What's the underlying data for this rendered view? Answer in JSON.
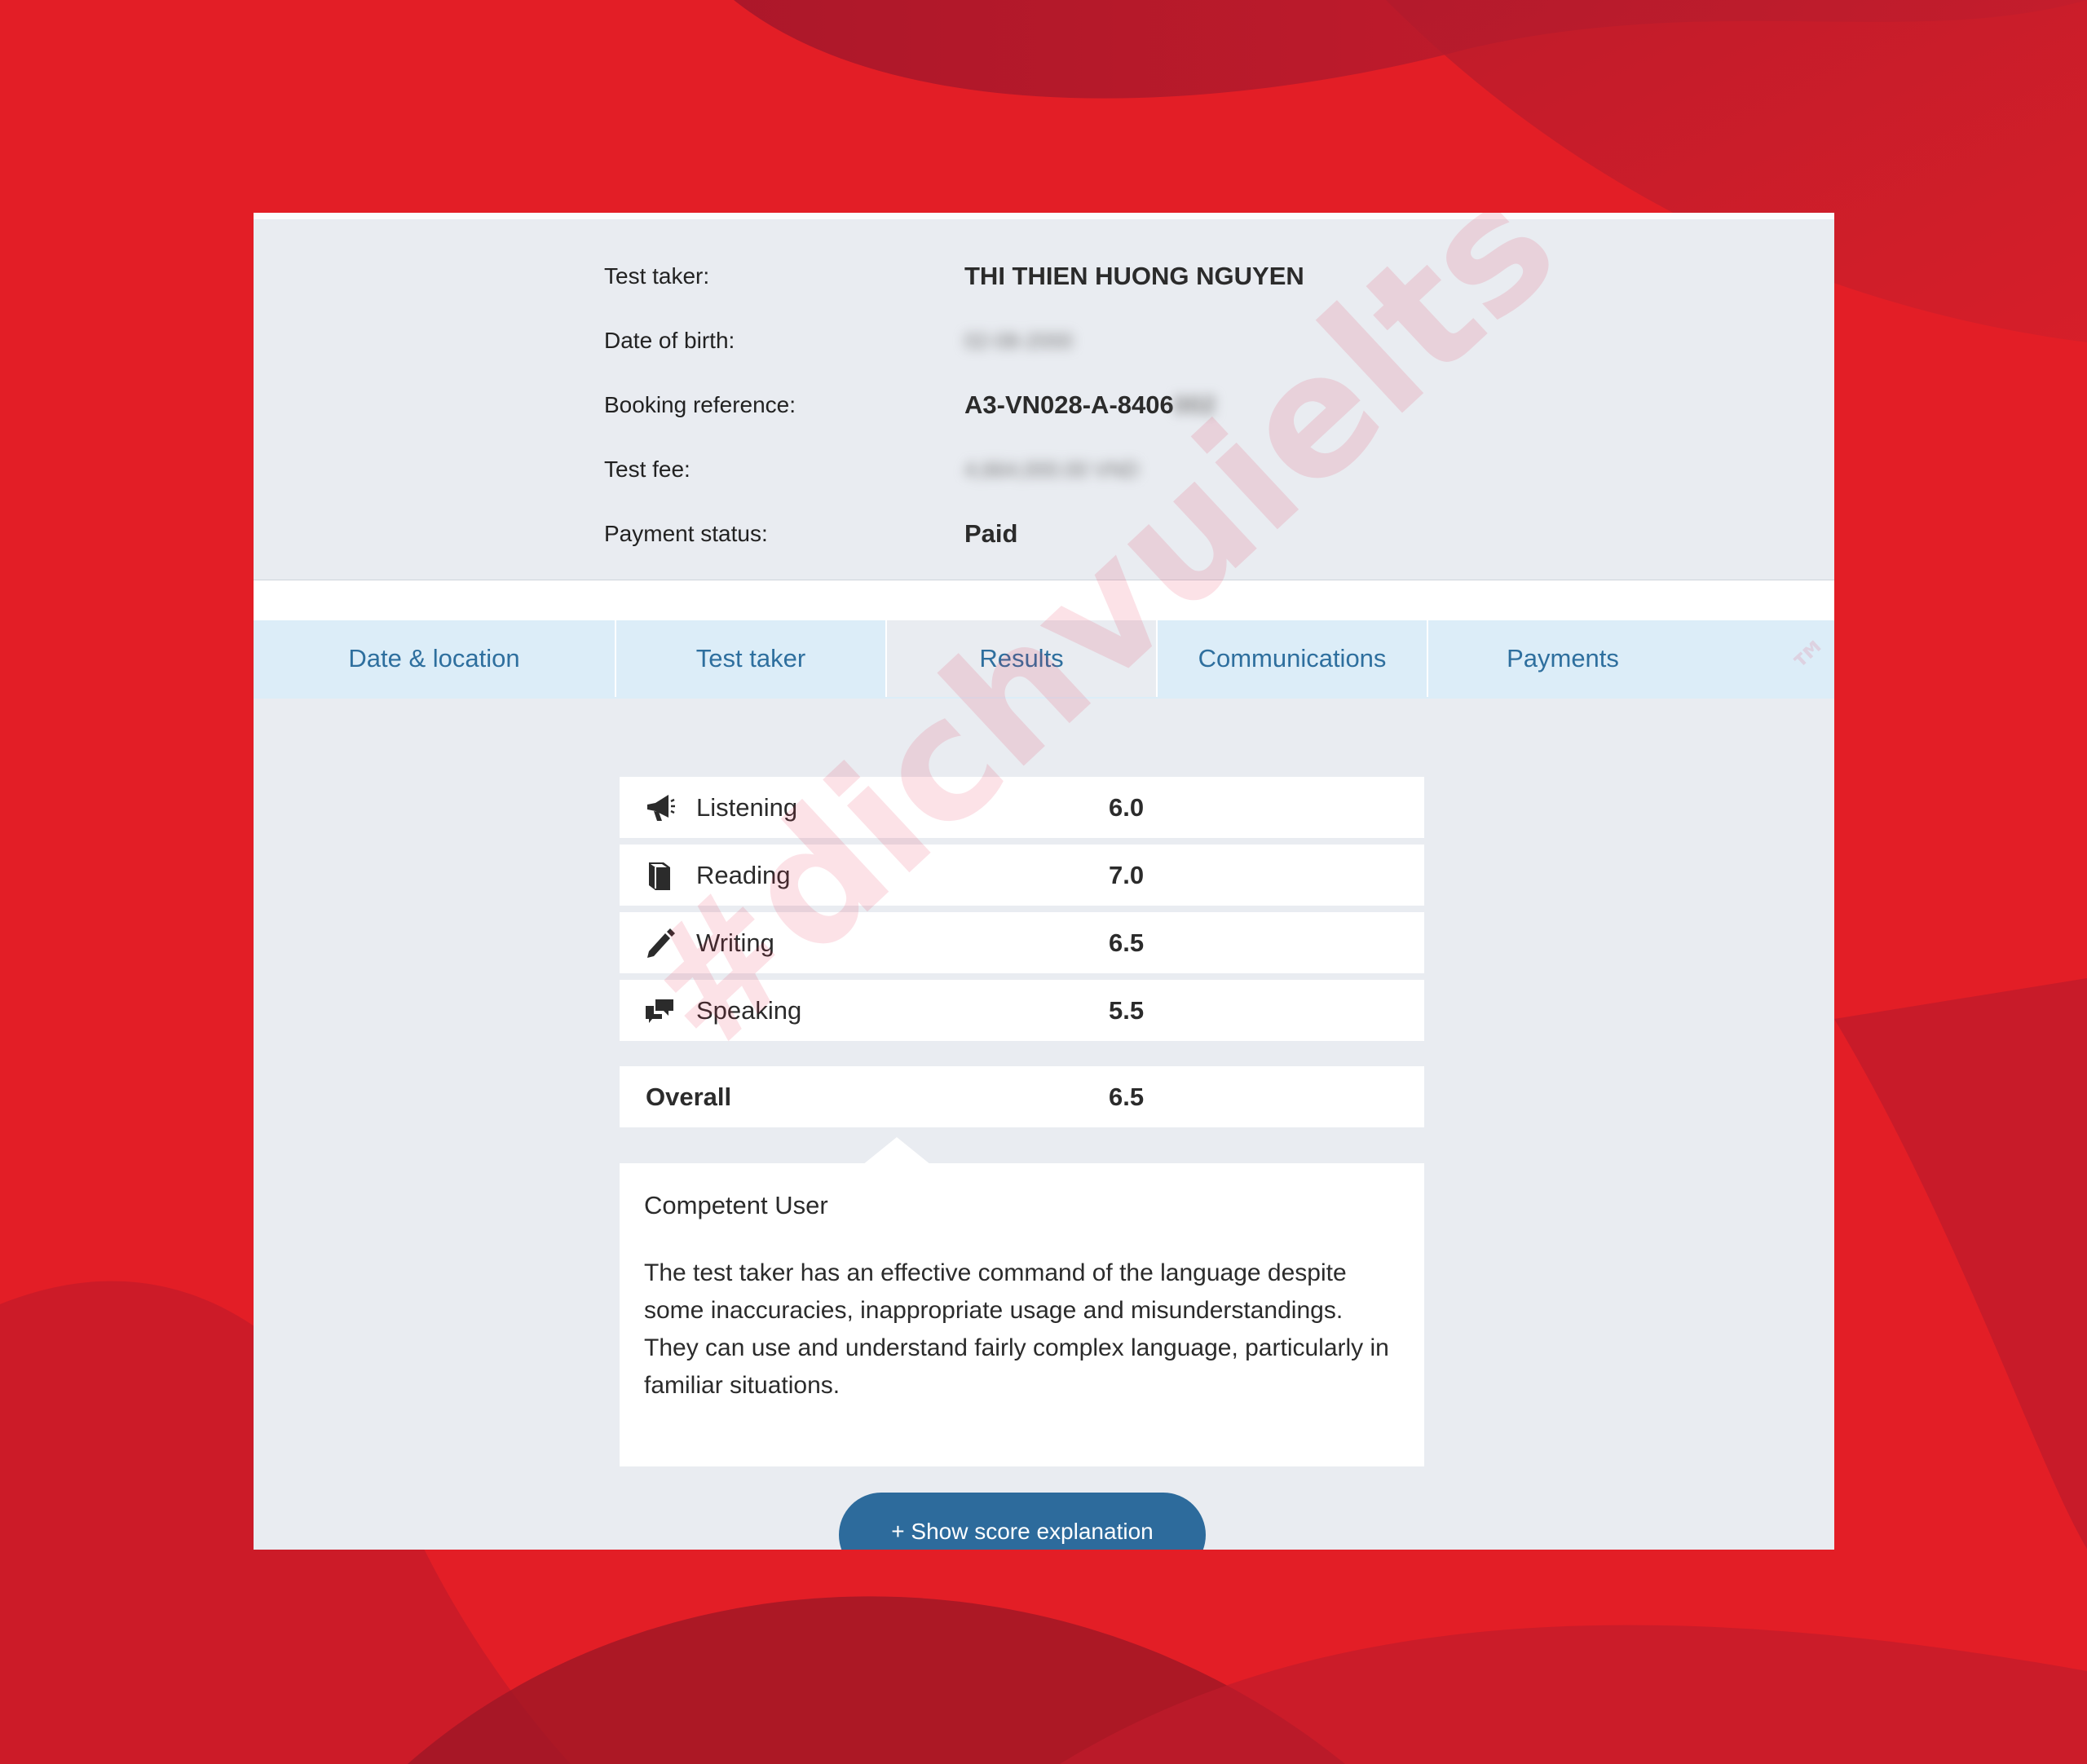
{
  "theme": {
    "background": "#e31e26",
    "card_background": "#e9ecf1",
    "tab_background": "#dcedf8",
    "tab_text": "#2e6f9e",
    "button": "#2d6b9c"
  },
  "profile": {
    "test_taker_label": "Test taker:",
    "test_taker_value": "THI THIEN HUONG NGUYEN",
    "dob_label": "Date of birth:",
    "dob_value": "02-08-2000",
    "booking_label": "Booking reference:",
    "booking_value": "A3-VN028-A-8406",
    "booking_hidden": "002",
    "fee_label": "Test fee:",
    "fee_value": "4,664,000.00 VND",
    "payment_label": "Payment status:",
    "payment_value": "Paid"
  },
  "tabs": [
    {
      "label": "Date & location"
    },
    {
      "label": "Test taker"
    },
    {
      "label": "Results"
    },
    {
      "label": "Communications"
    },
    {
      "label": "Payments"
    }
  ],
  "active_tab": "Results",
  "scores": [
    {
      "label": "Listening",
      "value": "6.0",
      "icon": "megaphone-icon"
    },
    {
      "label": "Reading",
      "value": "7.0",
      "icon": "book-icon"
    },
    {
      "label": "Writing",
      "value": "6.5",
      "icon": "pencil-icon"
    },
    {
      "label": "Speaking",
      "value": "5.5",
      "icon": "speech-bubbles-icon"
    }
  ],
  "overall": {
    "label": "Overall",
    "value": "6.5"
  },
  "band": {
    "title": "Competent User",
    "description": "The test taker has an effective command of the language despite some inaccuracies, inappropriate usage and misunderstandings. They can use and understand fairly complex language, particularly in familiar situations."
  },
  "button": {
    "label": "+ Show score explanation"
  },
  "watermark": {
    "text": "#dichvuielts",
    "tm": "™"
  }
}
